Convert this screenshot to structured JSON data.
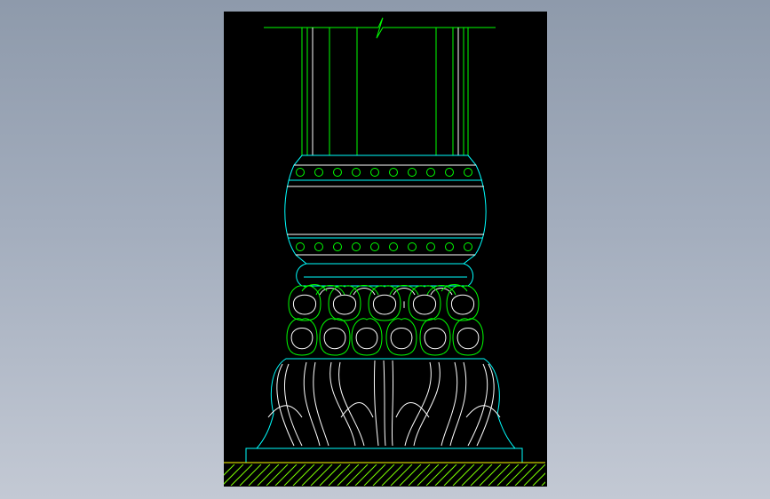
{
  "drawing": {
    "subject": "column-base-elevation",
    "background_color": "#000000",
    "viewport_background": "#9aa6b6",
    "colors": {
      "cyan": "#00ffff",
      "green": "#00ff00",
      "white": "#ffffff",
      "hatch": "#7fff00",
      "ground": "#ffff00"
    },
    "shaft_flute_count": 10,
    "bead_rows": 2,
    "beads_per_row": 10,
    "lotus_petals_upper_row": 5,
    "lotus_petals_lower_row": 6,
    "break_mark": "zigzag"
  }
}
